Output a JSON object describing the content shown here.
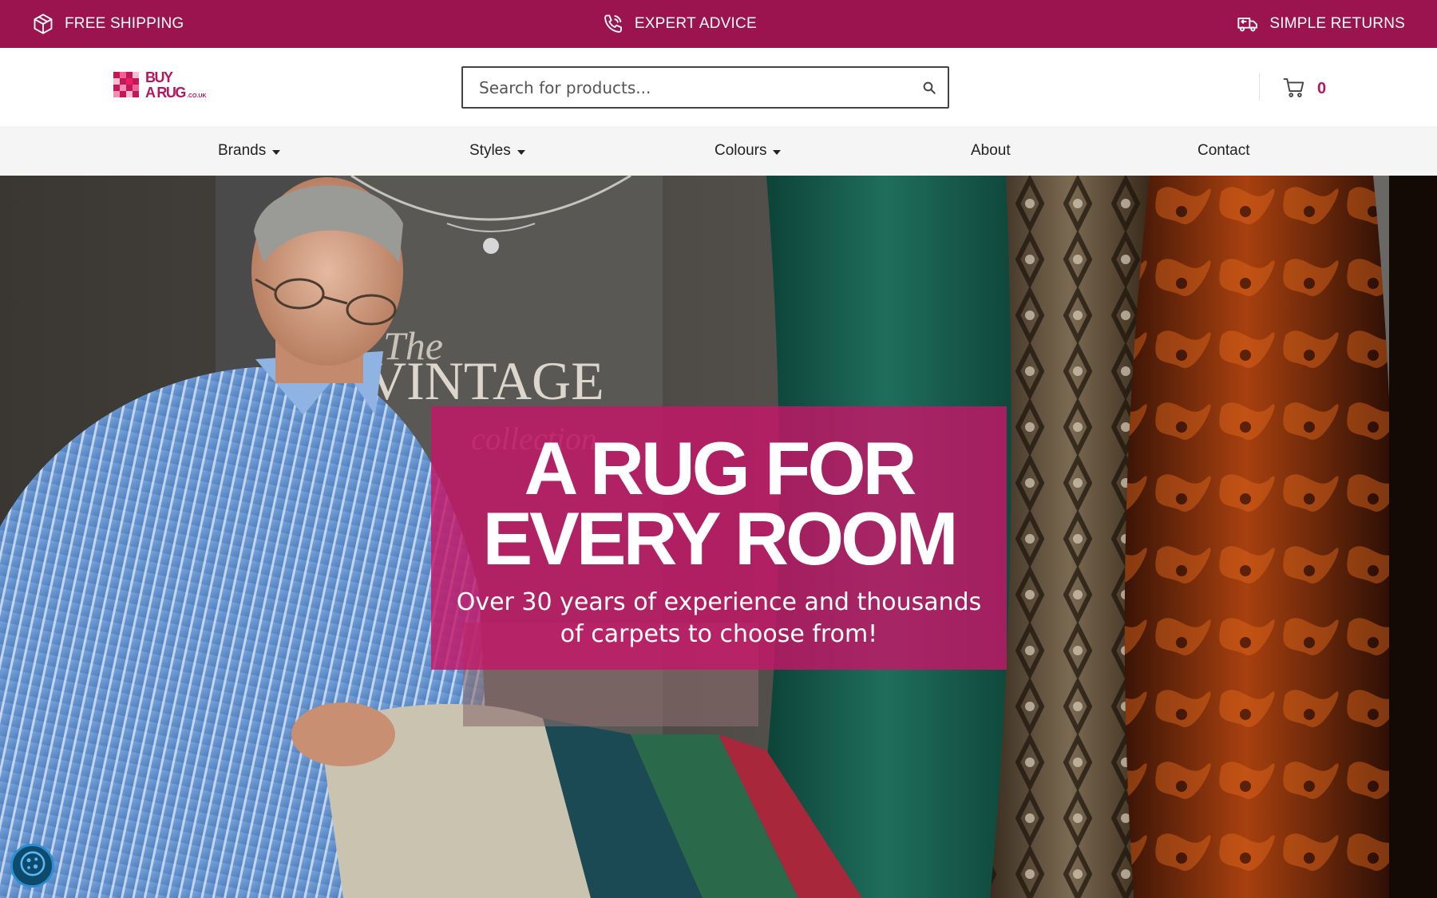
{
  "promo": {
    "items": [
      {
        "icon": "box-icon",
        "label": "FREE SHIPPING"
      },
      {
        "icon": "phone-icon",
        "label": "EXPERT ADVICE"
      },
      {
        "icon": "truck-return-icon",
        "label": "SIMPLE RETURNS"
      }
    ]
  },
  "header": {
    "logo_text": "BUY A RUG .CO.UK",
    "search_placeholder": "Search for products...",
    "cart_count": "0"
  },
  "nav": {
    "items": [
      {
        "label": "Brands",
        "has_dropdown": true
      },
      {
        "label": "Styles",
        "has_dropdown": true
      },
      {
        "label": "Colours",
        "has_dropdown": true
      },
      {
        "label": "About",
        "has_dropdown": false
      },
      {
        "label": "Contact",
        "has_dropdown": false
      }
    ]
  },
  "hero": {
    "title_line1": "A RUG FOR",
    "title_line2": "EVERY ROOM",
    "subtitle": "Over 30 years of experience and thousands of carpets to choose from!"
  },
  "colors": {
    "brand": "#9b1450",
    "accent": "#b5175e",
    "hero_box": "#c41668"
  }
}
